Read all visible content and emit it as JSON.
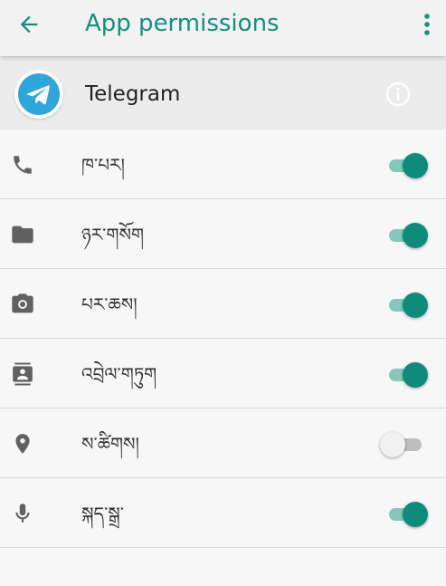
{
  "appbar": {
    "title": "App permissions",
    "back_icon": "arrow-left-icon",
    "overflow_icon": "more-vert-icon",
    "accent": "#168f7f"
  },
  "app": {
    "name": "Telegram",
    "icon": "telegram-icon",
    "info_icon": "info-icon"
  },
  "permissions": [
    {
      "label": "ཁ་པར།",
      "icon": "phone-icon",
      "enabled": true
    },
    {
      "label": "ཉར་གསོག",
      "icon": "folder-icon",
      "enabled": true
    },
    {
      "label": "པར་ཆས།",
      "icon": "camera-icon",
      "enabled": true
    },
    {
      "label": "འབྲེལ་གཏུག",
      "icon": "contacts-icon",
      "enabled": true
    },
    {
      "label": "ས་ཚིགས།",
      "icon": "location-icon",
      "enabled": false
    },
    {
      "label": "སྐད་སྒྲ་",
      "icon": "microphone-icon",
      "enabled": true
    }
  ],
  "colors": {
    "toggle_on_thumb": "#0d8c7b",
    "toggle_on_track": "#86c7bd",
    "toggle_off_thumb": "#f1f1f1",
    "toggle_off_track": "#bdbdbd"
  }
}
